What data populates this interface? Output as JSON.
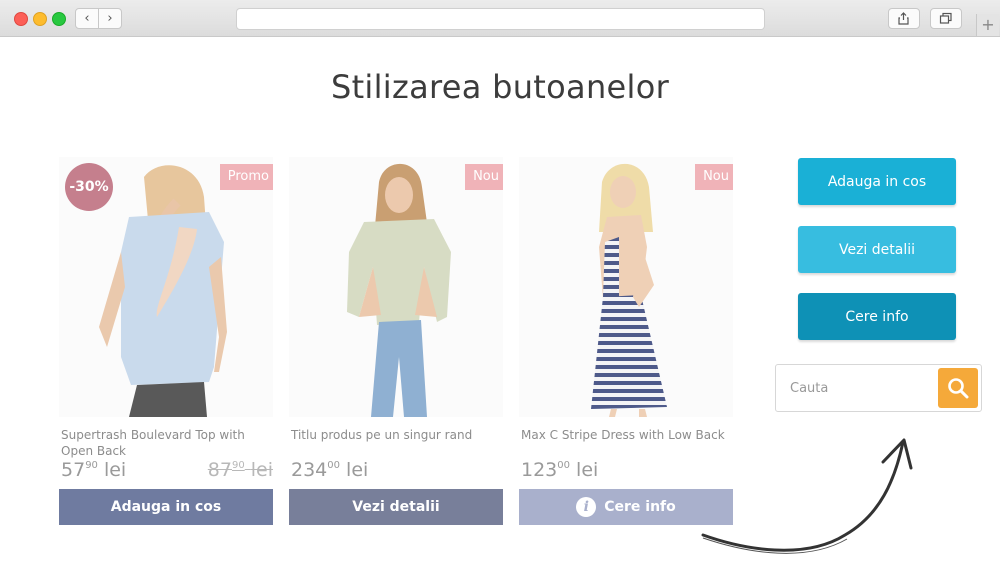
{
  "page": {
    "title": "Stilizarea butoanelor"
  },
  "products": [
    {
      "name": "Supertrash Boulevard Top with Open Back",
      "price_main": "57",
      "price_cents": "90",
      "currency": "lei",
      "old_price_main": "87",
      "old_price_cents": "90",
      "old_currency": "lei",
      "badge": "Promo",
      "discount": "-30%",
      "button_label": "Adauga in cos"
    },
    {
      "name": "Titlu produs pe un singur rand",
      "price_main": "234",
      "price_cents": "00",
      "currency": "lei",
      "badge": "Nou",
      "button_label": "Vezi detalii"
    },
    {
      "name": "Max C Stripe Dress with Low Back",
      "price_main": "123",
      "price_cents": "00",
      "currency": "lei",
      "badge": "Nou",
      "button_label": "Cere info",
      "button_icon": "info-icon",
      "button_icon_glyph": "i"
    }
  ],
  "sidebar": {
    "buttons": [
      "Adauga in cos",
      "Vezi detalii",
      "Cere info"
    ],
    "search_placeholder": "Cauta",
    "search_icon": "search-icon"
  },
  "colors": {
    "cyan": "#1ab0d6",
    "cyan_light": "#37bde0",
    "cyan_dark": "#0e91b6",
    "search_orange": "#f5a93a",
    "product_button": "#6f7ba0",
    "badge_pink": "#f0b3b8",
    "discount_circle": "#c57f8d"
  }
}
